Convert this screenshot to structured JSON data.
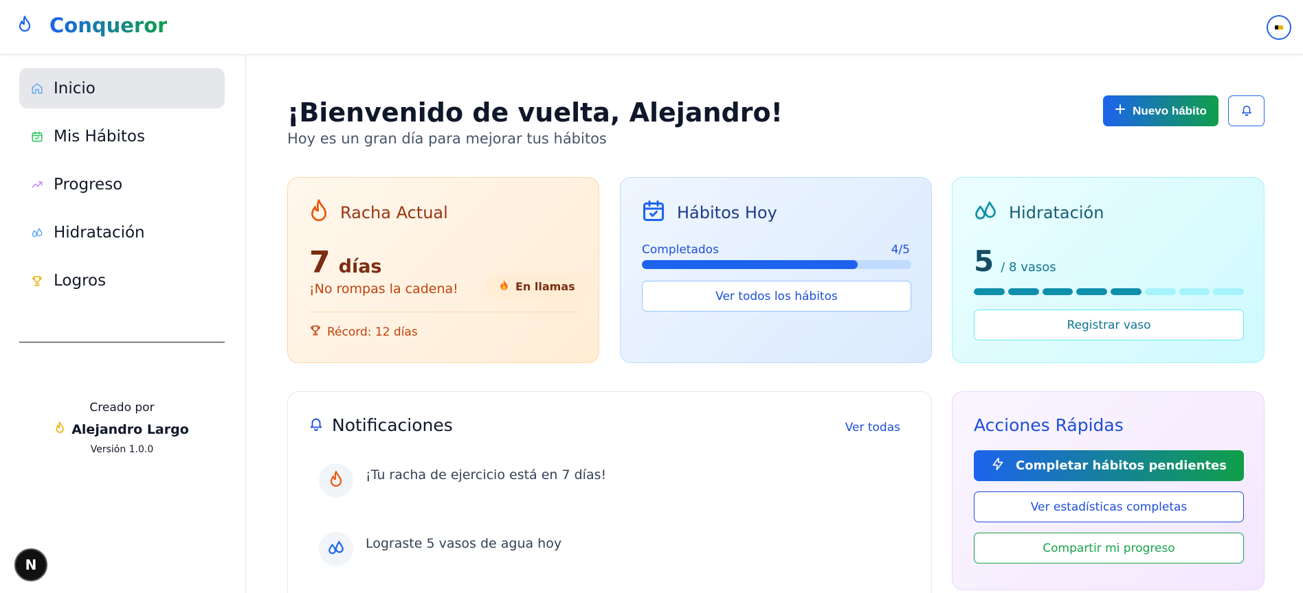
{
  "header": {
    "brand": "Conqueror"
  },
  "sidebar": {
    "items": [
      {
        "label": "Inicio",
        "icon": "home-icon"
      },
      {
        "label": "Mis Hábitos",
        "icon": "calendar-check-icon"
      },
      {
        "label": "Progreso",
        "icon": "trending-up-icon"
      },
      {
        "label": "Hidratación",
        "icon": "droplets-icon"
      },
      {
        "label": "Logros",
        "icon": "trophy-icon"
      }
    ],
    "credits": {
      "created_by": "Creado por",
      "author": "Alejandro Largo",
      "version": "Versión 1.0.0"
    },
    "badge": "N"
  },
  "main": {
    "welcome": "¡Bienvenido de vuelta, Alejandro!",
    "subtitle": "Hoy es un gran día para mejorar tus hábitos",
    "new_habit": "Nuevo hábito",
    "streak": {
      "title": "Racha Actual",
      "value": "7",
      "unit": "días",
      "message": "¡No rompas la cadena!",
      "badge": "En llamas",
      "record": "Récord: 12 días"
    },
    "habits": {
      "title": "Hábitos Hoy",
      "progress_label": "Completados",
      "progress_count": "4/5",
      "progress_fraction": 0.8,
      "button": "Ver todos los hábitos"
    },
    "water": {
      "title": "Hidratación",
      "value": "5",
      "of": "/ 8 vasos",
      "filled": 5,
      "total": 8,
      "button": "Registrar vaso"
    },
    "notifications": {
      "title": "Notificaciones",
      "see_all": "Ver todas",
      "items": [
        {
          "text": "¡Tu racha de ejercicio está en 7 días!",
          "icon": "flame-icon"
        },
        {
          "text": "Lograste 5 vasos de agua hoy",
          "icon": "droplets-icon"
        }
      ]
    },
    "quick": {
      "title": "Acciones Rápidas",
      "complete": "Completar hábitos pendientes",
      "stats": "Ver estadísticas completas",
      "share": "Compartir mi progreso"
    }
  },
  "colors": {
    "primary": "#1d63ed",
    "secondary": "#0f9f49",
    "streak": "#ea580c",
    "water": "#0e8fab"
  }
}
